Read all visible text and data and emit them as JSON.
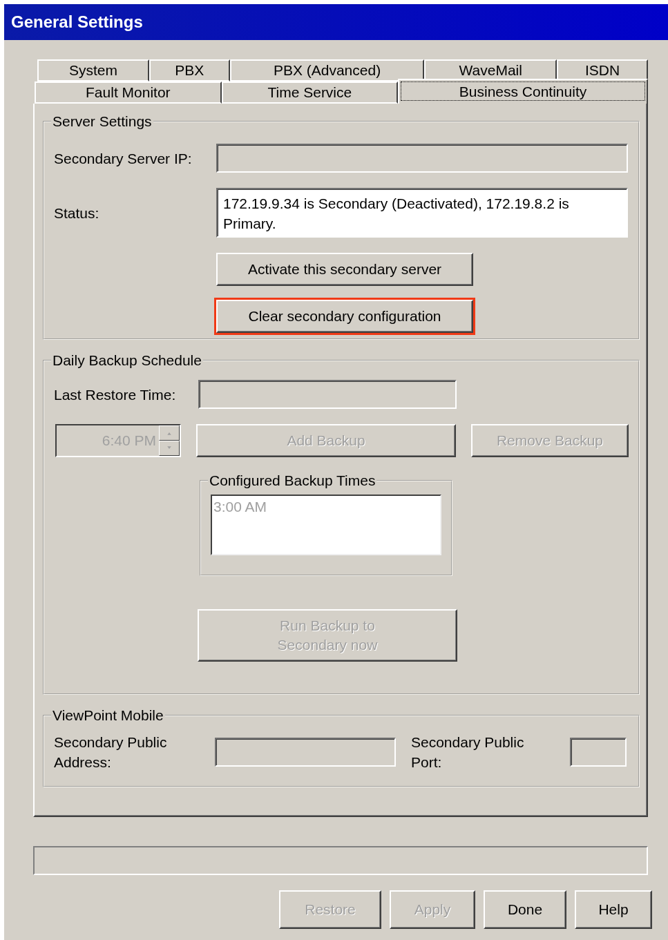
{
  "window": {
    "title": "General Settings"
  },
  "tab_rows": [
    {
      "tabs": [
        {
          "label": "System",
          "selected": false
        },
        {
          "label": "PBX",
          "selected": false
        },
        {
          "label": "PBX (Advanced)",
          "selected": false
        },
        {
          "label": "WaveMail",
          "selected": false
        },
        {
          "label": "ISDN",
          "selected": false
        }
      ]
    },
    {
      "tabs": [
        {
          "label": "Fault Monitor",
          "selected": false
        },
        {
          "label": "Time Service",
          "selected": false
        },
        {
          "label": "Business Continuity",
          "selected": true
        }
      ]
    }
  ],
  "server_settings": {
    "title": "Server Settings",
    "secondary_ip_label": "Secondary Server IP:",
    "status_label": "Status:",
    "status_value": "172.19.9.34 is Secondary (Deactivated), 172.19.8.2 is Primary.",
    "buttons": [
      {
        "label": "Activate this secondary server",
        "disabled": false,
        "highlighted": false
      },
      {
        "label": "Clear secondary configuration",
        "disabled": false,
        "highlighted": true
      }
    ]
  },
  "daily_backup": {
    "title": "Daily Backup Schedule",
    "last_restore_label": "Last Restore Time:",
    "time_spinner": {
      "value": "6:40 PM",
      "disabled": true
    },
    "add_button": {
      "label": "Add Backup",
      "disabled": true
    },
    "remove_button": {
      "label": "Remove Backup",
      "disabled": true
    },
    "configured": {
      "title": "Configured Backup Times",
      "disabled": true,
      "items": [
        {
          "label": "3:00 AM",
          "selected": false
        }
      ]
    },
    "run_button": {
      "label": "Run Backup to Secondary now",
      "disabled": true
    }
  },
  "viewpoint_mobile": {
    "title": "ViewPoint Mobile",
    "address_label": "Secondary Public Address:",
    "port_label": "Secondary Public Port:"
  },
  "dialog_buttons": [
    {
      "label": "Restore",
      "disabled": true
    },
    {
      "label": "Apply",
      "disabled": true
    },
    {
      "label": "Done",
      "disabled": false
    },
    {
      "label": "Help",
      "disabled": false
    }
  ]
}
